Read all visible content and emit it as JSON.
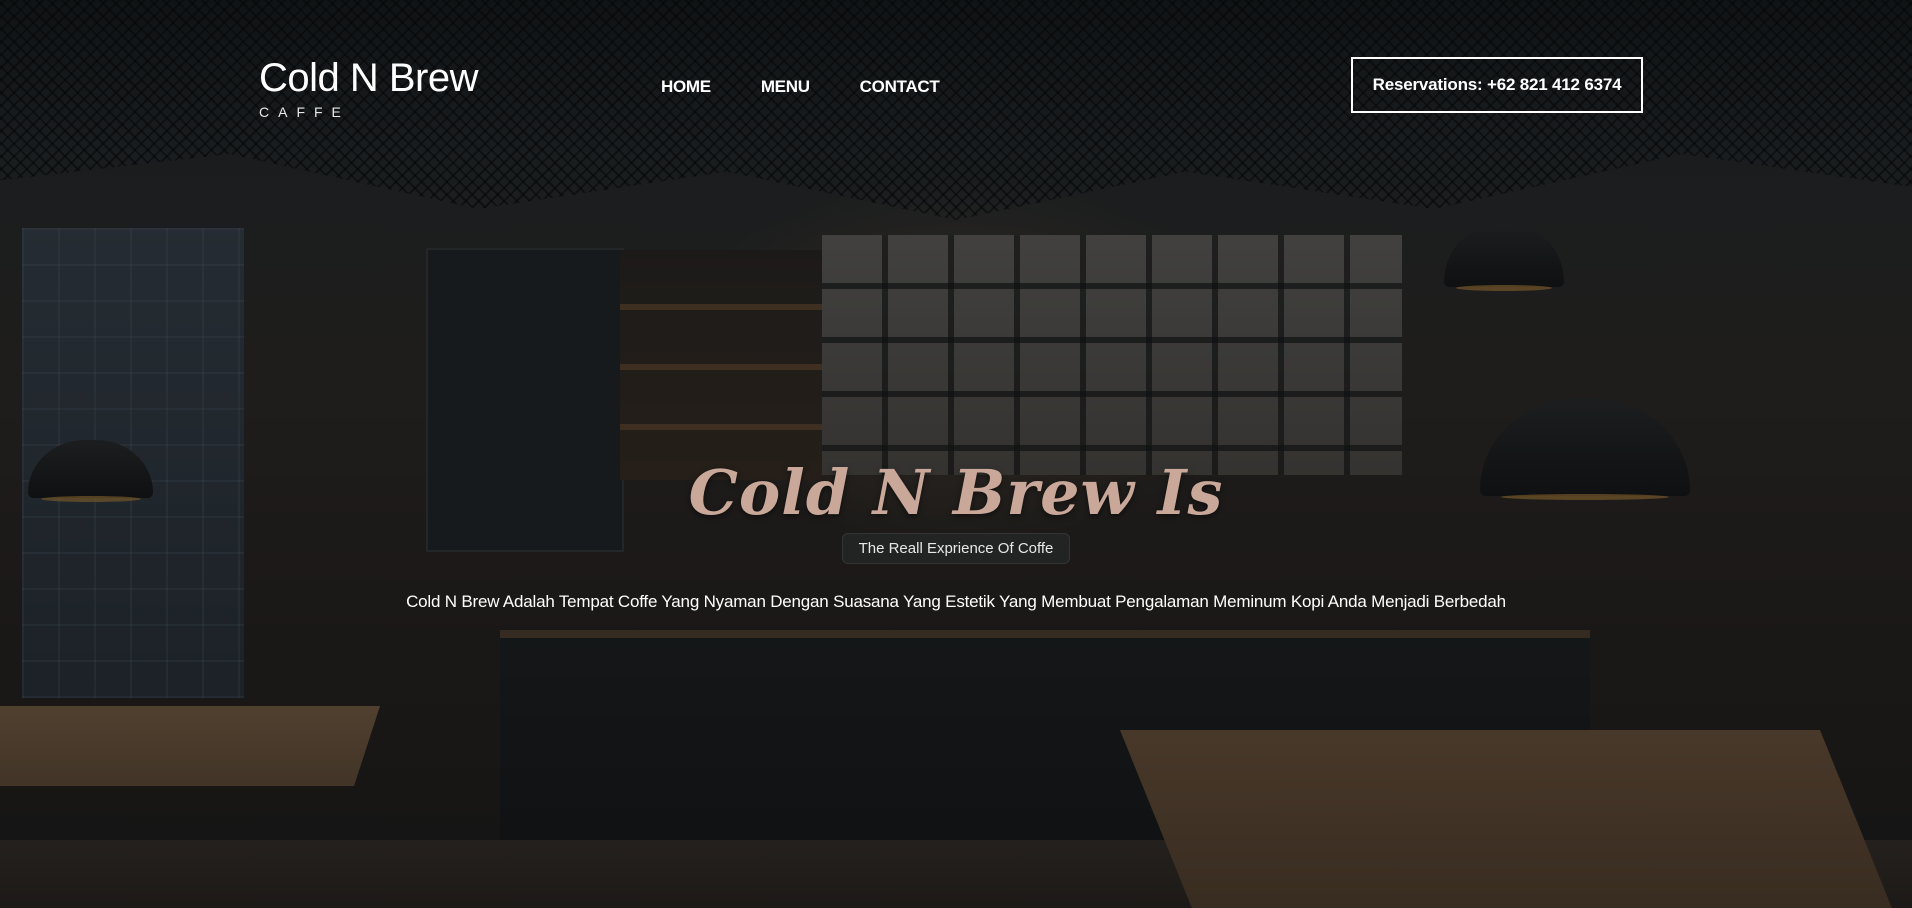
{
  "brand": {
    "title": "Cold N Brew",
    "subtitle": "CAFFE"
  },
  "nav": {
    "items": [
      {
        "label": "HOME"
      },
      {
        "label": "MENU"
      },
      {
        "label": "CONTACT"
      }
    ]
  },
  "reservation": {
    "label": "Reservations: +62 821 412 6374"
  },
  "hero": {
    "title": "Cold N Brew Is",
    "tagline": "The Reall Exprience Of Coffe",
    "description": "Cold N Brew Adalah Tempat Coffe Yang Nyaman Dengan Suasana Yang Estetik Yang Membuat Pengalaman Meminum Kopi Anda Menjadi Berbedah"
  },
  "colors": {
    "hero_title": "#c9a89a",
    "text": "#ffffff",
    "overlay": "#0a0e10"
  }
}
